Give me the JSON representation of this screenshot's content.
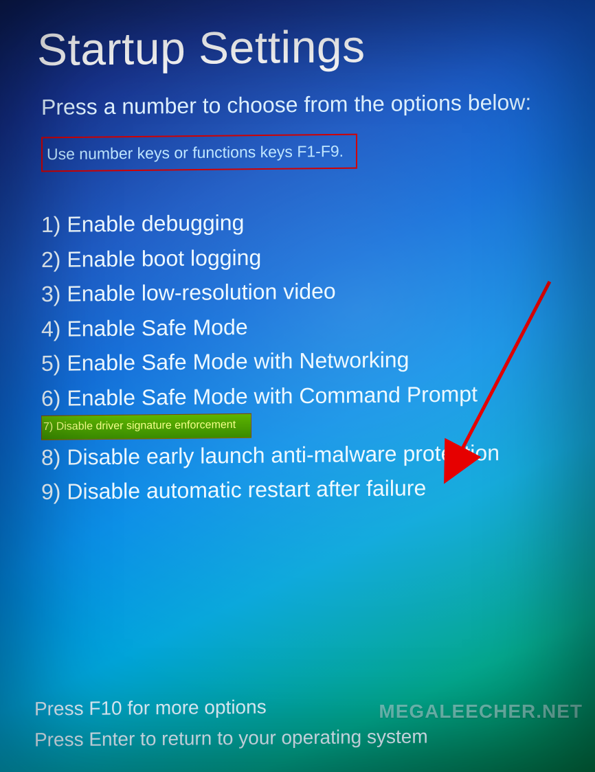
{
  "title": "Startup Settings",
  "subtitle": "Press a number to choose from the options below:",
  "hint": "Use number keys or functions keys F1-F9.",
  "options": [
    {
      "num": "1)",
      "label": "Enable debugging",
      "highlighted": false
    },
    {
      "num": "2)",
      "label": "Enable boot logging",
      "highlighted": false
    },
    {
      "num": "3)",
      "label": "Enable low-resolution video",
      "highlighted": false
    },
    {
      "num": "4)",
      "label": "Enable Safe Mode",
      "highlighted": false
    },
    {
      "num": "5)",
      "label": "Enable Safe Mode with Networking",
      "highlighted": false
    },
    {
      "num": "6)",
      "label": "Enable Safe Mode with Command Prompt",
      "highlighted": false
    },
    {
      "num": "7)",
      "label": "Disable driver signature enforcement",
      "highlighted": true
    },
    {
      "num": "8)",
      "label": "Disable early launch anti-malware protection",
      "highlighted": false
    },
    {
      "num": "9)",
      "label": "Disable automatic restart after failure",
      "highlighted": false
    }
  ],
  "footer": {
    "more": "Press F10 for more options",
    "return": "Press Enter to return to your operating system"
  },
  "watermark": "MEGALEECHER.NET",
  "annotation": {
    "hint_box_color": "#d10000",
    "highlight_bg": "#4aa400",
    "highlight_text": "#f4ff8a",
    "arrow_color": "#e60000"
  }
}
